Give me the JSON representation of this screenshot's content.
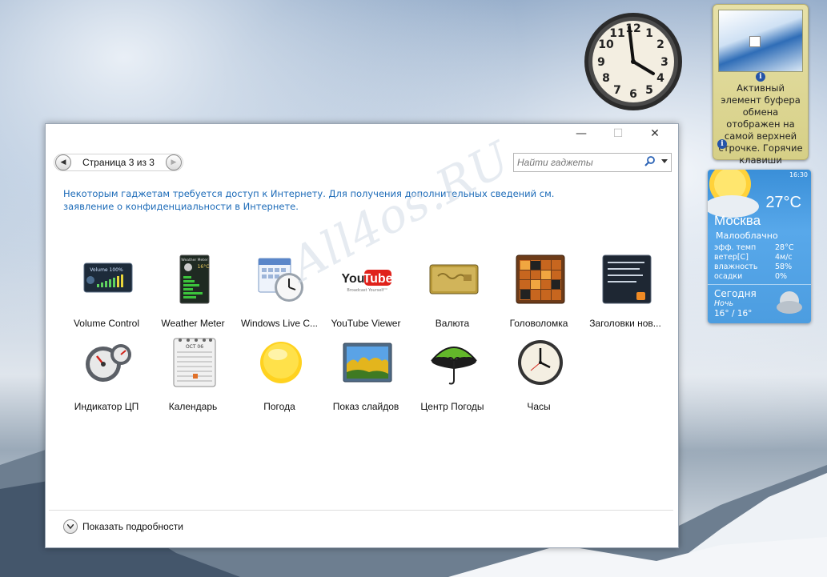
{
  "window": {
    "controls": {
      "minimize": "—",
      "maximize": "☐",
      "close": "✕"
    },
    "nav": {
      "page_label": "Страница 3 из 3"
    },
    "search": {
      "placeholder": "Найти гаджеты"
    },
    "notice": "Некоторым гаджетам требуется доступ к Интернету. Для получения дополнительных сведений см. заявление о конфиденциальности в Интернете.",
    "gadgets_row1": [
      {
        "label": "Volume Control",
        "icon": "volume-control-icon"
      },
      {
        "label": "Weather Meter",
        "icon": "weather-meter-icon"
      },
      {
        "label": "Windows Live C...",
        "icon": "calendar-clock-icon"
      },
      {
        "label": "YouTube Viewer",
        "icon": "youtube-icon"
      },
      {
        "label": "Валюта",
        "icon": "currency-icon"
      },
      {
        "label": "Головоломка",
        "icon": "puzzle-icon"
      },
      {
        "label": "Заголовки нов...",
        "icon": "news-headlines-icon"
      }
    ],
    "gadgets_row2": [
      {
        "label": "Индикатор ЦП",
        "icon": "cpu-meter-icon"
      },
      {
        "label": "Календарь",
        "icon": "calendar-icon"
      },
      {
        "label": "Погода",
        "icon": "weather-sun-icon"
      },
      {
        "label": "Показ слайдов",
        "icon": "slideshow-icon"
      },
      {
        "label": "Центр Погоды",
        "icon": "weather-center-umbrella-icon"
      },
      {
        "label": "Часы",
        "icon": "clock-icon"
      }
    ],
    "details_label": "Показать подробности"
  },
  "icon_texts": {
    "volume": "Volume 100%",
    "weather_meter": "Weather Meter",
    "weather_meter_temp": "16°C",
    "youtube_you": "You",
    "youtube_tube": "Tube",
    "youtube_slogan": "Broadcast Yourself™",
    "calendar_month": "ОСТ 06"
  },
  "desktop": {
    "watermark": "All4os.RU",
    "clipboard_gadget": {
      "text": "Активный элемент буфера обмена отображен на самой верхней строчке. Горячие клавиши недоступны"
    },
    "weather_gadget": {
      "time": "16:30",
      "temperature": "27°C",
      "city": "Москва",
      "condition": "Малооблачно",
      "rows": [
        {
          "label": "эфф. темп",
          "value": "28°C"
        },
        {
          "label": "ветер[С]",
          "value": "4м/с"
        },
        {
          "label": "влажность",
          "value": "58%"
        },
        {
          "label": "осадки",
          "value": "0%"
        }
      ],
      "today": "Сегодня",
      "night": "Ночь",
      "range": "16° / 16°"
    }
  },
  "colors": {
    "link_blue": "#1c6bb8",
    "weather_bg": "#4c9de0",
    "clip_bg": "#ddd698"
  }
}
